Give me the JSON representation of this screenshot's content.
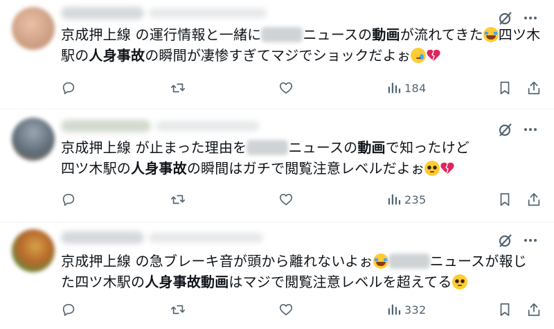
{
  "posts": [
    {
      "pre": "京成押上線 の運行情報と一緒に",
      "mid1": "ニュースの",
      "bold1": "動画",
      "mid2": "が流れてきた",
      "line2_a": "四ツ木",
      "line2_b": "駅の",
      "bold2": "人身事故",
      "line2_c": "の瞬間が凄惨すぎてマジでショックだよぉ",
      "views": "184",
      "emojis": [
        "loudly-crying-face",
        "crying-face",
        "broken-heart"
      ]
    },
    {
      "pre": "京成押上線 が止まった理由を",
      "mid1": "ニュースの",
      "bold1": "動画",
      "mid2": "で知ったけど",
      "line2_a": "四ツ木駅の",
      "bold2": "人身事故",
      "line2_c": "の瞬間はガチで閲覧注意レベルだよぉ",
      "views": "235",
      "emojis": [
        "pleading-face",
        "broken-heart"
      ]
    },
    {
      "pre": "京成押上線 の急ブレーキ音が頭から離れないよぉ",
      "mid1": "ニュースが報じ",
      "line2_a": "た四ツ木駅の",
      "bold2": "人身事故動画",
      "line2_c": "はマジで閲覧注意レベルを超えてる",
      "views": "332",
      "emojis": [
        "loudly-crying-face",
        "pleading-face"
      ]
    }
  ],
  "colors": {
    "icon": "#536471",
    "text": "#0f1419",
    "divider": "#eff3f4",
    "heart": "#e0245e"
  },
  "icons": [
    "grok-icon",
    "more-icon",
    "reply-icon",
    "repost-icon",
    "like-icon",
    "views-icon",
    "bookmark-icon",
    "share-icon"
  ]
}
